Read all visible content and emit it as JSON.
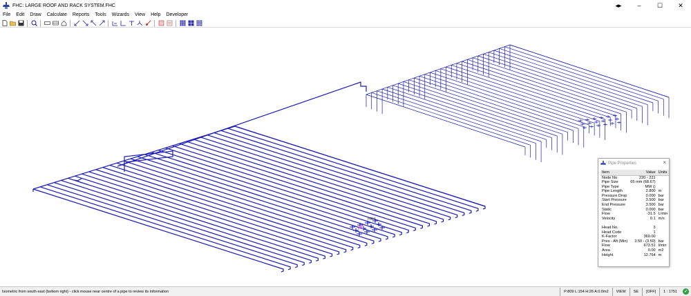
{
  "title": "FHC: LARGE ROOF AND RACK SYSTEM.FHC",
  "window_controls": {
    "extra": "◂▸",
    "minimize": "–",
    "maximize": "☐",
    "close": "✕"
  },
  "menu": [
    "File",
    "Edit",
    "Draw",
    "Calculate",
    "Reports",
    "Tools",
    "Wizards",
    "View",
    "Help",
    "Developer"
  ],
  "toolbar": [
    "new-file",
    "open-folder",
    "save-disk",
    "zoom",
    "rect-a",
    "rect-b",
    "home",
    "arrow-sw",
    "arrow-se",
    "arrow-nw",
    "arrow-ne",
    "pipe-a",
    "pipe-b",
    "pipe-c",
    "pipe-d",
    "brush",
    "report-a",
    "report-b",
    "grid-a",
    "grid-b",
    "grid-c"
  ],
  "panel": {
    "title": "Pipe Properties",
    "headers": {
      "item": "Item",
      "value": "Value",
      "units": "Units"
    },
    "rows": [
      {
        "item": "Node No",
        "value": "220 - 221",
        "units": ""
      },
      {
        "item": "Pipe Size",
        "value": "65 mm (68.67)",
        "units": ""
      },
      {
        "item": "Pipe Type",
        "value": "MW ()",
        "units": ""
      },
      {
        "item": "Pipe Length",
        "value": "2.800",
        "units": "m"
      },
      {
        "item": "Pressure Drop",
        "value": "0.000",
        "units": "bar"
      },
      {
        "item": "Start Pressure",
        "value": "3.500",
        "units": "bar"
      },
      {
        "item": "End Pressure",
        "value": "3.500",
        "units": "bar"
      },
      {
        "item": "Static",
        "value": "0.000",
        "units": "bar"
      },
      {
        "item": "Flow",
        "value": "-31.5",
        "units": "L/min"
      },
      {
        "item": "Velocity",
        "value": "0.1",
        "units": "m/s"
      },
      {
        "item": "",
        "value": "",
        "units": ""
      },
      {
        "item": "Head No.",
        "value": "3",
        "units": ""
      },
      {
        "item": "Head Code",
        "value": "1",
        "units": ""
      },
      {
        "item": "K-Factor",
        "value": "360.00",
        "units": ""
      },
      {
        "item": "Pres - Aft (Min)",
        "value": "3.50 - (3.50)",
        "units": "bar"
      },
      {
        "item": "Flow",
        "value": "673.51",
        "units": "l/min"
      },
      {
        "item": "Area",
        "value": "0.00",
        "units": "m2"
      },
      {
        "item": "Height",
        "value": "12.764",
        "units": "m"
      }
    ]
  },
  "canvas": {
    "label": "HRH",
    "line_color": "#1a1ab8",
    "marker_color": "#e070e0",
    "roof_branch_count": 30,
    "rack_branch_count": 28
  },
  "status": {
    "message": "Isometric from south east (bottom right) - click mouse near centre of a pipe to review its information",
    "position": "P:809 L:154 H:26 A:0.0m2",
    "view": "VIEW",
    "direction": "SE",
    "mode": "[OFF]",
    "scale": "1 : 1751",
    "ok_icon": "✔"
  }
}
